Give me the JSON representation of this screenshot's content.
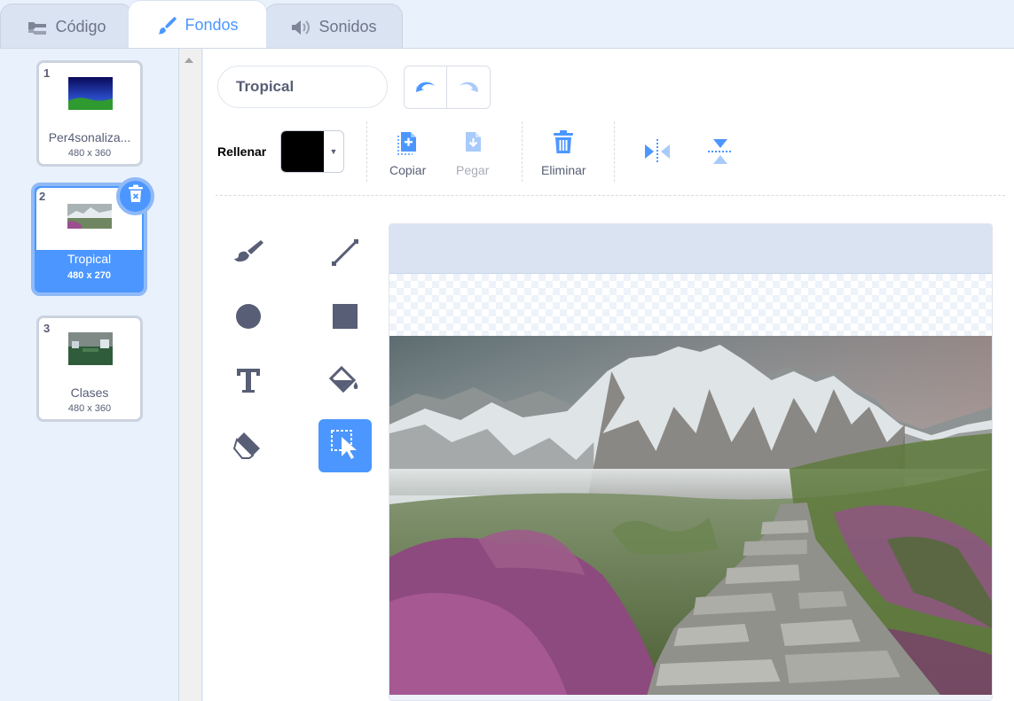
{
  "tabs": [
    {
      "label": "Código",
      "icon": "code-icon"
    },
    {
      "label": "Fondos",
      "icon": "brush-icon",
      "active": true
    },
    {
      "label": "Sonidos",
      "icon": "speaker-icon"
    }
  ],
  "backdrops": [
    {
      "num": "1",
      "name": "Per4sonaliza...",
      "size": "480 x 360"
    },
    {
      "num": "2",
      "name": "Tropical",
      "size": "480 x 270",
      "selected": true
    },
    {
      "num": "3",
      "name": "Clases",
      "size": "480 x 360"
    }
  ],
  "editor": {
    "costume_name": "Tropical",
    "fill_label": "Rellenar",
    "fill_color": "#000000",
    "copy_label": "Copiar",
    "paste_label": "Pegar",
    "delete_label": "Eliminar"
  },
  "colors": {
    "accent": "#4c97ff",
    "tool_icon": "#575e75"
  }
}
